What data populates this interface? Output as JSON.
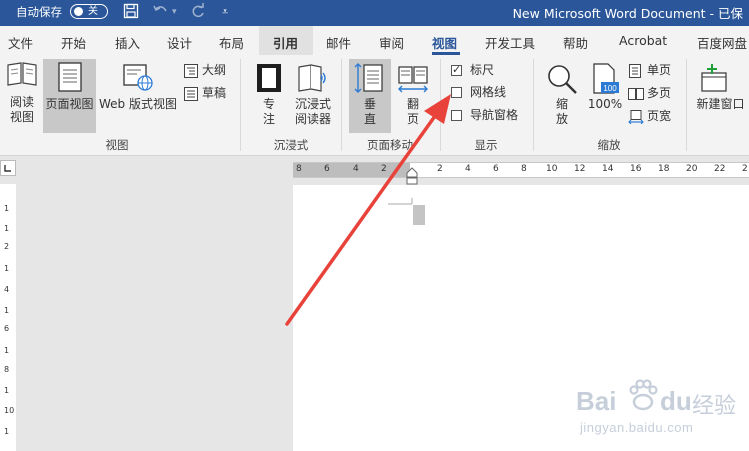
{
  "titlebar": {
    "autosave_label": "自动保存",
    "toggle_label": "关",
    "doc_title": "New Microsoft Word Document - 已保"
  },
  "tabs": [
    "文件",
    "开始",
    "插入",
    "设计",
    "布局",
    "引用",
    "邮件",
    "审阅",
    "视图",
    "开发工具",
    "帮助",
    "Acrobat",
    "百度网盘"
  ],
  "active_tab": "视图",
  "ribbon": {
    "views": {
      "read_mode": "阅读\n视图",
      "print_layout": "页面视图",
      "web_layout": "Web 版式视图",
      "outline": "大纲",
      "draft": "草稿",
      "group": "视图"
    },
    "immersive": {
      "focus": "专\n注",
      "immersive_reader": "沉浸式\n阅读器",
      "group": "沉浸式"
    },
    "page_movement": {
      "vertical": "垂\n直",
      "side_to_side": "翻\n页",
      "group": "页面移动"
    },
    "show": {
      "ruler": "标尺",
      "gridlines": "网格线",
      "navigation_pane": "导航窗格",
      "group": "显示",
      "ruler_checked": true,
      "gridlines_checked": false,
      "navigation_checked": false
    },
    "zoom": {
      "zoom": "缩\n放",
      "hundred": "100%",
      "one_page": "单页",
      "multiple_pages": "多页",
      "page_width": "页宽",
      "group": "缩放"
    },
    "window": {
      "new_window": "新建窗口"
    }
  },
  "ruler": {
    "h_numbers": [
      "8",
      "6",
      "4",
      "2",
      "2",
      "4",
      "6",
      "8",
      "10",
      "12",
      "14",
      "16",
      "18",
      "20",
      "22",
      "2"
    ],
    "v_numbers": [
      "1",
      "1",
      "2",
      "1",
      "4",
      "1",
      "6",
      "1",
      "8",
      "1",
      "10",
      "1"
    ]
  },
  "watermark": {
    "brand": "Bai",
    "brand2": "du",
    "brand3": "经验",
    "url": "jingyan.baidu.com"
  },
  "colors": {
    "title_bar": "#2b579a",
    "accent": "#2b579a",
    "arrow": "#e8423a"
  }
}
